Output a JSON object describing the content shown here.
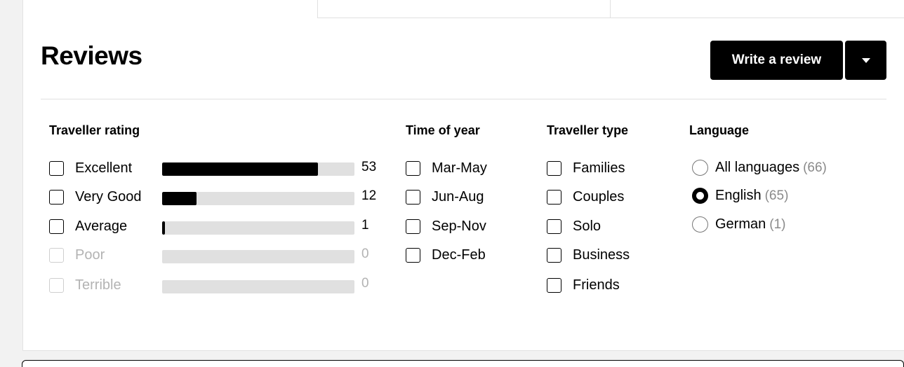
{
  "header": {
    "title": "Reviews",
    "write_review_label": "Write a review",
    "dropdown_icon": "caret-down-icon"
  },
  "traveller_rating": {
    "title": "Traveller rating",
    "max_count": 53,
    "items": [
      {
        "label": "Excellent",
        "count": "53",
        "fill": 0.81,
        "enabled": true
      },
      {
        "label": "Very Good",
        "count": "12",
        "fill": 0.18,
        "enabled": true
      },
      {
        "label": "Average",
        "count": "1",
        "fill": 0.01,
        "enabled": true
      },
      {
        "label": "Poor",
        "count": "0",
        "fill": 0,
        "enabled": false
      },
      {
        "label": "Terrible",
        "count": "0",
        "fill": 0,
        "enabled": false
      }
    ]
  },
  "time_of_year": {
    "title": "Time of year",
    "items": [
      "Mar-May",
      "Jun-Aug",
      "Sep-Nov",
      "Dec-Feb"
    ]
  },
  "traveller_type": {
    "title": "Traveller type",
    "items": [
      "Families",
      "Couples",
      "Solo",
      "Business",
      "Friends"
    ]
  },
  "language": {
    "title": "Language",
    "selected": "English",
    "items": [
      {
        "label": "All languages",
        "count": "(66)"
      },
      {
        "label": "English",
        "count": "(65)"
      },
      {
        "label": "German",
        "count": "(1)"
      }
    ]
  },
  "colors": {
    "accent": "#000000",
    "bar_track": "#e0e0e0",
    "disabled_text": "#b3b3b3"
  }
}
